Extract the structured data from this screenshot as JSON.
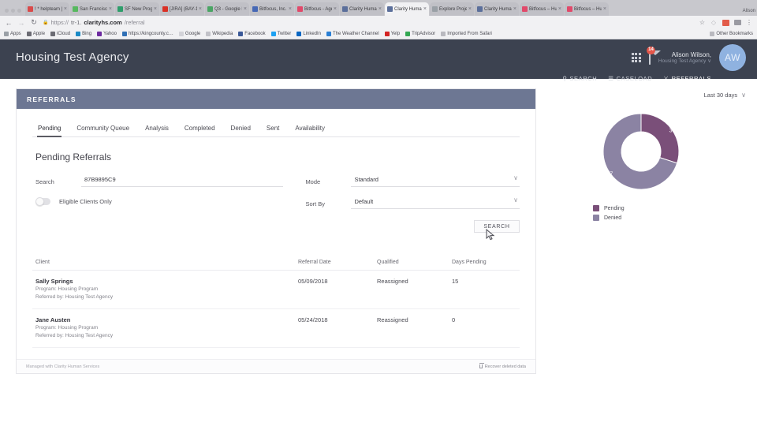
{
  "browser": {
    "tabs": [
      {
        "title": "! * helpteam | ",
        "favicon": "#d94a4a",
        "active": false
      },
      {
        "title": "San Francisco",
        "favicon": "#57b85f",
        "active": false
      },
      {
        "title": "SF New Progr…",
        "favicon": "#2e9e6b",
        "active": false
      },
      {
        "title": "[JIRA] (BAY-1…",
        "favicon": "#d93025",
        "active": false
      },
      {
        "title": "Q3 - Google D…",
        "favicon": "#4aa564",
        "active": false
      },
      {
        "title": "Bitfocus, Inc. -",
        "favicon": "#4668b5",
        "active": false
      },
      {
        "title": "Bitfocus - Agen",
        "favicon": "#e1496a",
        "active": false
      },
      {
        "title": "Clarity Human ",
        "favicon": "#5b6f9b",
        "active": false
      },
      {
        "title": "Clarity Human ",
        "favicon": "#5b6f9b",
        "active": true
      },
      {
        "title": "Explore Projec…",
        "favicon": "#9aa0a6",
        "active": false
      },
      {
        "title": "Clarity Human ",
        "favicon": "#5b6f9b",
        "active": false
      },
      {
        "title": "Bitfocus – Hum…",
        "favicon": "#e1496a",
        "active": false
      },
      {
        "title": "Bitfocus – Hum…",
        "favicon": "#e1496a",
        "active": false
      }
    ],
    "close_glyph": "×",
    "profile_name": "Alison",
    "nav": {
      "back": "←",
      "forward": "→",
      "reload": "↻"
    },
    "url": {
      "lock": "🔒",
      "scheme": "https://",
      "host_pre": "tr-1.",
      "host_main": "clarityhs.com",
      "path": "/referral"
    },
    "star_glyph": "☆",
    "menu_glyph": "⋮",
    "bookmarks": [
      {
        "label": "Apps",
        "color": "#9aa0a6"
      },
      {
        "label": "Apple",
        "color": "#6b6b73"
      },
      {
        "label": "iCloud",
        "color": "#6b6b73"
      },
      {
        "label": "Bing",
        "color": "#1b8ac6"
      },
      {
        "label": "Yahoo",
        "color": "#6d2ba0"
      },
      {
        "label": "https://kingcounty.c…",
        "color": "#2f6fb5"
      },
      {
        "label": "Google",
        "color": "#d3d3d8"
      },
      {
        "label": "Wikipedia",
        "color": "#c2c2c8"
      },
      {
        "label": "Facebook",
        "color": "#3b5998"
      },
      {
        "label": "Twitter",
        "color": "#1da1f2"
      },
      {
        "label": "LinkedIn",
        "color": "#0a66c2"
      },
      {
        "label": "The Weather Channel",
        "color": "#2a7fd4"
      },
      {
        "label": "Yelp",
        "color": "#d32323"
      },
      {
        "label": "TripAdvisor",
        "color": "#34a853"
      },
      {
        "label": "Imported From Safari",
        "color": "#b9b9bf"
      }
    ],
    "other_bookmarks": "Other Bookmarks"
  },
  "header": {
    "agency_title": "Housing Test Agency",
    "user_name": "Alison Wilson,",
    "user_agency": "Housing Test Agency",
    "user_caret": "∨",
    "avatar_initials": "AW",
    "notification_count": "14",
    "nav": [
      {
        "label": "SEARCH",
        "icon": "search-icon",
        "glyph": "⚲",
        "active": false
      },
      {
        "label": "CASELOAD",
        "icon": "caseload-icon",
        "glyph": "☰",
        "active": false
      },
      {
        "label": "REFERRALS",
        "icon": "referrals-icon",
        "glyph": "⚔",
        "active": true
      }
    ]
  },
  "card": {
    "title": "REFERRALS",
    "tabs": [
      {
        "label": "Pending",
        "active": true
      },
      {
        "label": "Community Queue",
        "active": false
      },
      {
        "label": "Analysis",
        "active": false
      },
      {
        "label": "Completed",
        "active": false
      },
      {
        "label": "Denied",
        "active": false
      },
      {
        "label": "Sent",
        "active": false
      },
      {
        "label": "Availability",
        "active": false
      }
    ],
    "section_title": "Pending Referrals",
    "form": {
      "search_label": "Search",
      "search_value": "87B9895C9",
      "search_placeholder": "",
      "toggle_label": "Eligible Clients Only",
      "toggle_state": "off",
      "mode_label": "Mode",
      "mode_value": "Standard",
      "sort_label": "Sort By",
      "sort_value": "Default",
      "dropdown_caret": "∨",
      "search_button": "SEARCH"
    },
    "table": {
      "columns": [
        "Client",
        "Referral Date",
        "Qualified",
        "Days Pending"
      ],
      "rows": [
        {
          "client": "Sally Springs",
          "program": "Program: Housing Program",
          "referred_by": "Referred by: Housing Test Agency",
          "referral_date": "05/09/2018",
          "qualified": "Reassigned",
          "days_pending": "15"
        },
        {
          "client": "Jane Austen",
          "program": "Program: Housing Program",
          "referred_by": "Referred by: Housing Test Agency",
          "referral_date": "05/24/2018",
          "qualified": "Reassigned",
          "days_pending": "0"
        }
      ]
    },
    "footer": {
      "left": "Managed with Clarity Human Services",
      "right": "Recover deleted data"
    }
  },
  "panel": {
    "range_label": "Last 30 days",
    "range_caret": "∨"
  },
  "chart_data": {
    "type": "pie",
    "title": "",
    "subtype": "donut",
    "categories": [
      "Pending",
      "Denied"
    ],
    "values": [
      3,
      7
    ],
    "colors": [
      "#7a4f79",
      "#8b83a3"
    ],
    "labels": [
      "3",
      "7"
    ],
    "legend_position": "bottom",
    "total": 10
  },
  "colors": {
    "header_bg": "#3c4250",
    "card_head_bg": "#6d7793",
    "accent_pending": "#7a4f79",
    "accent_denied": "#8b83a3",
    "badge": "#e4564a",
    "avatar": "#8fb2e0"
  }
}
